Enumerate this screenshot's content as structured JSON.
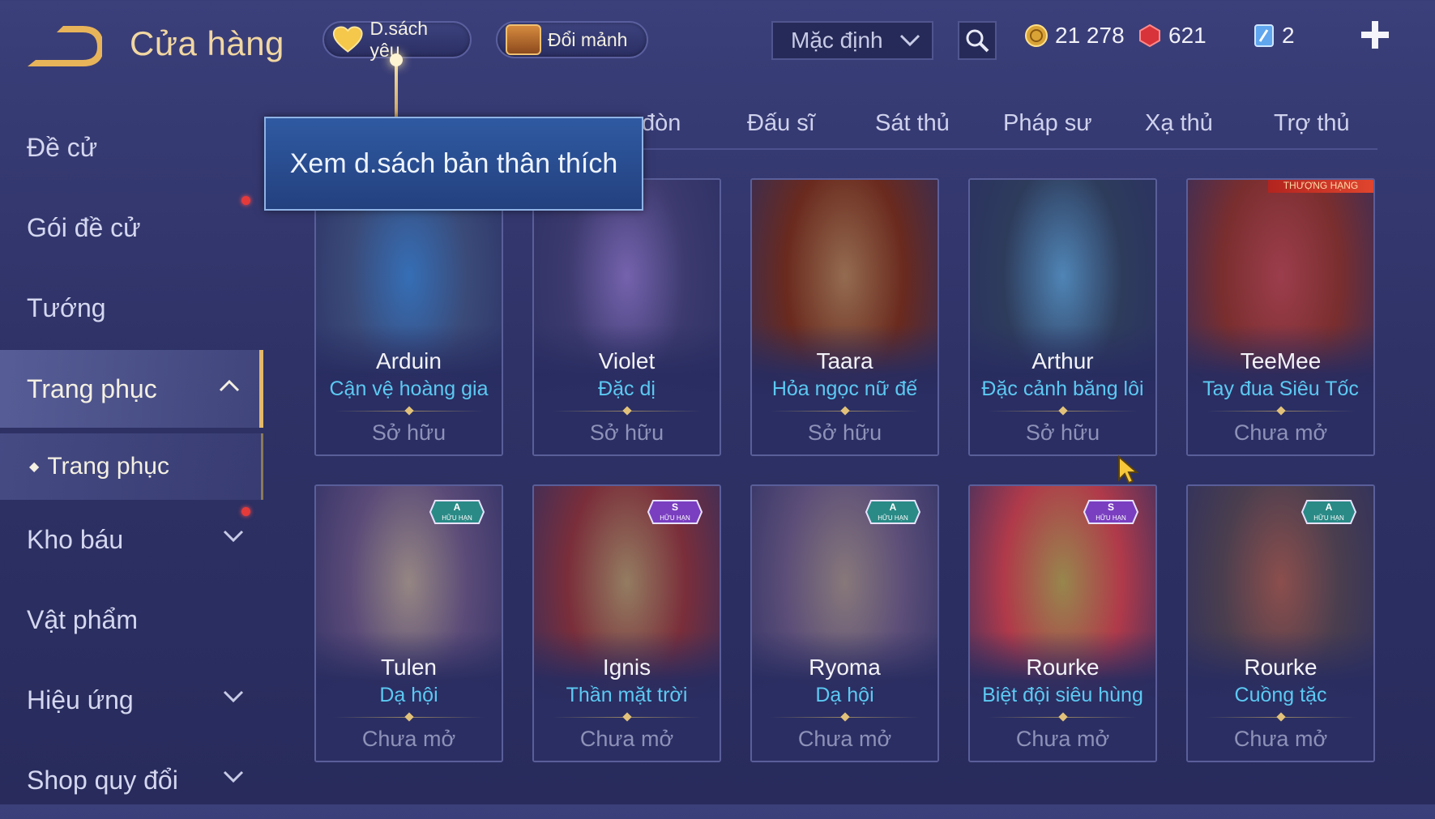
{
  "header": {
    "title": "Cửa hàng",
    "favorites_label": "D.sách yêu",
    "exchange_label": "Đổi mảnh",
    "sort_selected": "Mặc định",
    "currencies": {
      "gold": "21 278",
      "gems": "621",
      "tickets": "2"
    }
  },
  "tooltip": {
    "text": "Xem d.sách bản thân thích"
  },
  "sidebar": {
    "items": [
      {
        "label": "Đề cử"
      },
      {
        "label": "Gói đề cử"
      },
      {
        "label": "Tướng"
      },
      {
        "label": "Trang phục"
      },
      {
        "label": "Kho báu"
      },
      {
        "label": "Vật phẩm"
      },
      {
        "label": "Hiệu ứng"
      },
      {
        "label": "Shop quy đổi"
      }
    ],
    "sub_item": {
      "label": "Trang phục"
    }
  },
  "tabs": [
    {
      "label": "đòn"
    },
    {
      "label": "Đấu sĩ"
    },
    {
      "label": "Sát thủ"
    },
    {
      "label": "Pháp sư"
    },
    {
      "label": "Xạ thủ"
    },
    {
      "label": "Trợ thủ"
    }
  ],
  "cards": [
    {
      "hero": "Arduin",
      "skin": "Cận vệ hoàng gia",
      "status": "Sở hữu",
      "tone": "#3a4a78",
      "accent": "#3fa6ff"
    },
    {
      "hero": "Violet",
      "skin": "Đặc dị",
      "status": "Sở hữu",
      "tone": "#3c3a6e",
      "accent": "#b690f0"
    },
    {
      "hero": "Taara",
      "skin": "Hỏa ngọc nữ đế",
      "status": "Sở hữu",
      "tone": "#6a2a1e",
      "accent": "#f0a040"
    },
    {
      "hero": "Arthur",
      "skin": "Đặc cảnh băng lôi",
      "status": "Sở hữu",
      "tone": "#2e3c5c",
      "accent": "#6fd0ff"
    },
    {
      "hero": "TeeMee",
      "skin": "Tay đua Siêu Tốc",
      "status": "Chưa mở",
      "tone": "#7a2e2e",
      "accent": "#ff4a3a",
      "ribbon": "THƯỢNG HẠNG"
    },
    {
      "hero": "Tulen",
      "skin": "Dạ hội",
      "status": "Chưa mở",
      "tone": "#5a4a78",
      "accent": "#f2d2a0",
      "badge_tier": "A",
      "badge_text": "HỮU HẠN"
    },
    {
      "hero": "Ignis",
      "skin": "Thần mặt trời",
      "status": "Chưa mở",
      "tone": "#7a2e3a",
      "accent": "#f0c060",
      "badge_tier": "S",
      "badge_text": "HỮU HẠN"
    },
    {
      "hero": "Ryoma",
      "skin": "Dạ hội",
      "status": "Chưa mở",
      "tone": "#5c4e78",
      "accent": "#d8b890",
      "badge_tier": "A",
      "badge_text": "HỮU HẠN"
    },
    {
      "hero": "Rourke",
      "skin": "Biệt đội siêu hùng",
      "status": "Chưa mở",
      "tone": "#b03a4a",
      "accent": "#f6d23a",
      "badge_tier": "S",
      "badge_text": "HỮU HẠN"
    },
    {
      "hero": "Rourke",
      "skin": "Cuồng tặc",
      "status": "Chưa mở",
      "tone": "#4a3e4e",
      "accent": "#e06a3a",
      "badge_tier": "A",
      "badge_text": "HỮU HẠN"
    }
  ],
  "colors": {
    "background": "#2e3266",
    "title_gold": "#f1d7a2",
    "skin_name_blue": "#5cc9f2",
    "tooltip_blue": "#2f5aa2",
    "notification_red": "#e53a3a"
  }
}
